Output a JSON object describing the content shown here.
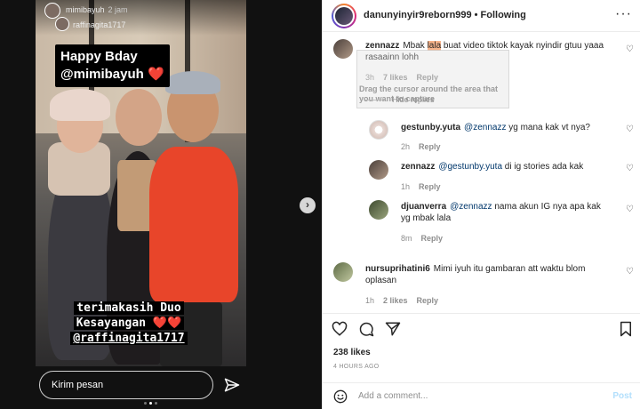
{
  "story": {
    "username": "mimibayuh",
    "time": "2 jam",
    "tagged_user": "raffinagita1717",
    "sticker_top": {
      "line1": "Happy Bday",
      "line2": "@mimibayuh",
      "heart": "❤️"
    },
    "sticker_bottom": {
      "line1": "terimakasih Duo",
      "line2": "Kesayangan",
      "hearts": "❤️❤️",
      "tag": "@raffinagita1717"
    },
    "reply_placeholder": "Kirim pesan",
    "send_icon": "send-icon",
    "dots_count": 3,
    "active_dot": 1
  },
  "next_button": {
    "icon": "chevron-right-icon",
    "glyph": "›"
  },
  "post": {
    "header": {
      "username": "danunyinyir9reborn999",
      "separator": "•",
      "follow_state": "Following",
      "more": "···"
    },
    "watermark": {
      "line1": "Drag the cursor around the area that",
      "line2": "you want to capture"
    },
    "comments": [
      {
        "user": "zennazz",
        "text_before": "Mbak ",
        "highlight": "lala",
        "text_after": " buat video tiktok kayak nyindir gtuu yaaa rasaainn lohh",
        "time": "3h",
        "likes": "7 likes",
        "reply": "Reply"
      },
      {
        "user": "gestunby.yuta",
        "mention": "@zennazz",
        "text": " yg mana kak vt nya?",
        "time": "2h",
        "reply": "Reply"
      },
      {
        "user": "zennazz",
        "mention": "@gestunby.yuta",
        "text": " di ig stories ada kak",
        "time": "1h",
        "reply": "Reply"
      },
      {
        "user": "djuanverra",
        "mention": "@zennazz",
        "text": " nama akun IG nya apa kak yg mbak lala",
        "time": "8m",
        "reply": "Reply"
      },
      {
        "user": "nursuprihatini6",
        "text": "Mimi iyuh itu gambaran att waktu blom oplasan",
        "time": "1h",
        "likes": "2 likes",
        "reply": "Reply"
      }
    ],
    "hide_replies": "Hide replies",
    "likes": "238 likes",
    "time_ago": "4 HOURS AGO",
    "add_comment_placeholder": "Add a comment...",
    "post_button": "Post"
  },
  "colors": {
    "link": "#00376b",
    "highlight": "#f7b48b",
    "muted": "#8e8e8e",
    "post_disabled": "#b2dffc"
  }
}
